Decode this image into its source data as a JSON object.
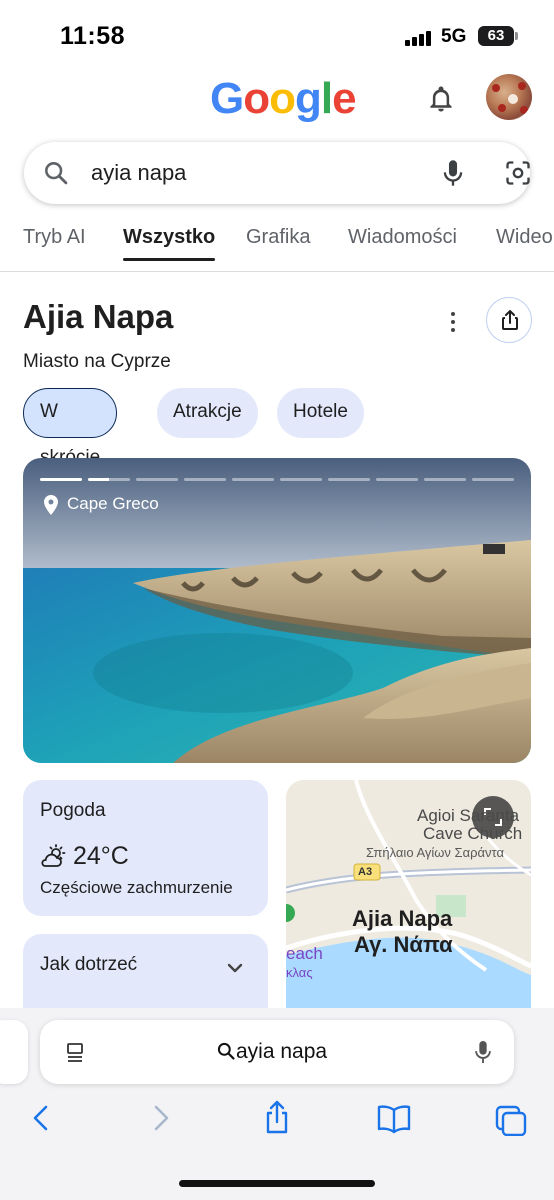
{
  "status_bar": {
    "time": "11:58",
    "network": "5G",
    "battery": "63"
  },
  "header": {
    "logo": "Google",
    "notifications_icon": "bell-icon",
    "avatar_icon": "account-avatar"
  },
  "search": {
    "query": "ayia napa",
    "icons": [
      "search-icon",
      "mic-icon",
      "lens-icon"
    ]
  },
  "tabs": [
    {
      "label": "Tryb AI",
      "active": false
    },
    {
      "label": "Wszystko",
      "active": true
    },
    {
      "label": "Grafika",
      "active": false
    },
    {
      "label": "Wiadomości",
      "active": false
    },
    {
      "label": "Wideo",
      "active": false
    }
  ],
  "knowledge_panel": {
    "title": "Ajia Napa",
    "subtitle": "Miasto na Cyprze",
    "chips": [
      {
        "label": "W skrócie",
        "selected": true
      },
      {
        "label": "Atrakcje",
        "selected": false
      },
      {
        "label": "Hotele",
        "selected": false
      }
    ],
    "image": {
      "location": "Cape Greco",
      "slide_count": 10,
      "current_slide": 2,
      "slide_progress": 0.5
    }
  },
  "weather_card": {
    "title": "Pogoda",
    "temperature": "24°C",
    "condition": "Częściowe zachmurzenie",
    "icon": "partly-cloudy-icon"
  },
  "directions_card": {
    "title": "Jak dotrzeć",
    "icon": "chevron-down-icon"
  },
  "map_card": {
    "place_label_1": "Agioi Saranta",
    "place_label_2": "Cave Church",
    "place_label_greek": "Σπήλαιο Αγίων Σαράντα",
    "road_label": "A3",
    "city_label": "Ajia Napa",
    "city_label_greek": "Αγ. Νάπα",
    "beach_label": "each",
    "beach_label_greek": "κλας"
  },
  "safari": {
    "url_text": "ayia napa",
    "toolbar_icons": [
      "back-icon",
      "forward-icon",
      "share-icon",
      "bookmarks-icon",
      "tabs-icon"
    ]
  },
  "colors": {
    "accent": "#1a73e8",
    "chip_bg": "#e3e9fb",
    "selected_chip_border": "#0b2a55",
    "safari_blue": "#1a73e8"
  }
}
